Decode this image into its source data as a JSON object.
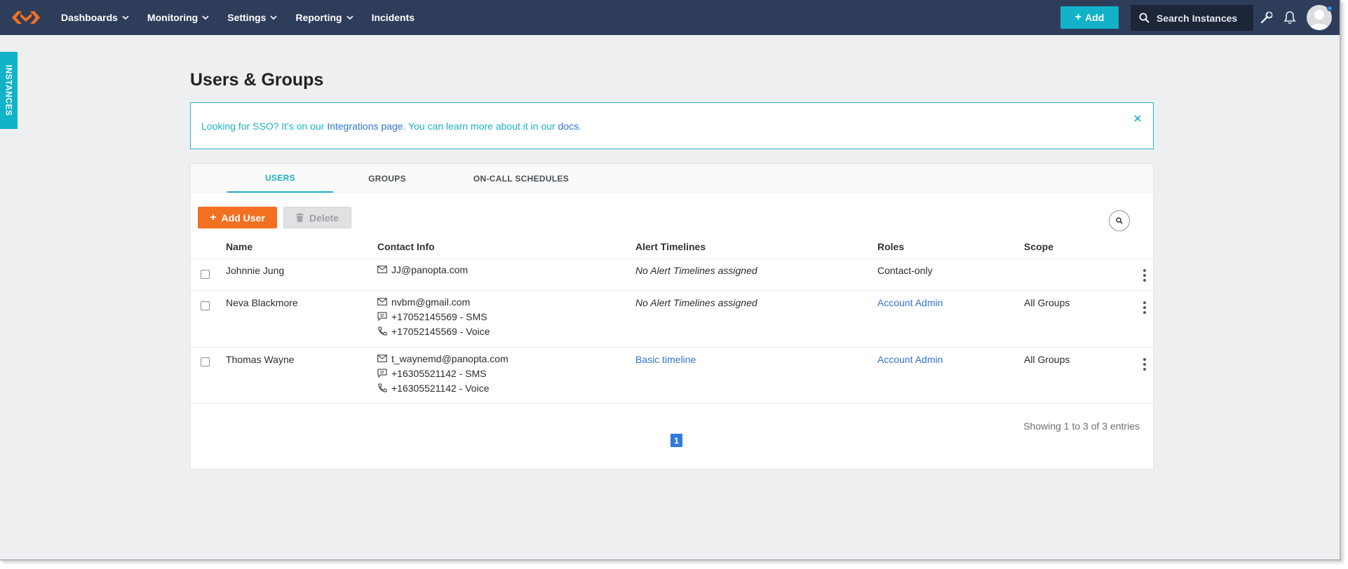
{
  "navbar": {
    "menu": [
      {
        "label": "Dashboards",
        "has_dropdown": true
      },
      {
        "label": "Monitoring",
        "has_dropdown": true
      },
      {
        "label": "Settings",
        "has_dropdown": true
      },
      {
        "label": "Reporting",
        "has_dropdown": true
      },
      {
        "label": "Incidents",
        "has_dropdown": false
      }
    ],
    "add_label": "Add",
    "search_placeholder": "Search Instances",
    "icons": [
      "logo-icon",
      "search-icon",
      "wrench-icon",
      "bell-icon",
      "avatar-icon"
    ],
    "colors": {
      "navbar_bg": "#2e3d5a",
      "accent": "#12b2c9",
      "notification_dot": "#2f8af0"
    }
  },
  "side_tab": {
    "label": "INSTANCES"
  },
  "page": {
    "title": "Users & Groups",
    "alert": {
      "text_1": "Looking for SSO? It's on our ",
      "link_1": "Integrations page",
      "text_2": ". You can learn more about it in our ",
      "link_2": "docs",
      "text_3": "."
    }
  },
  "tabs": [
    {
      "label": "USERS",
      "active": true
    },
    {
      "label": "GROUPS",
      "active": false
    },
    {
      "label": "ON-CALL SCHEDULES",
      "active": false
    }
  ],
  "toolbar": {
    "add_user_label": "Add User",
    "delete_label": "Delete",
    "add_user_color": "#f37021"
  },
  "table": {
    "columns": [
      "Name",
      "Contact Info",
      "Alert Timelines",
      "Roles",
      "Scope"
    ],
    "rows": [
      {
        "name": "Johnnie Jung",
        "contacts": [
          {
            "type": "email",
            "value": "JJ@panopta.com"
          }
        ],
        "alert_timeline": "No Alert Timelines assigned",
        "timeline_is_link": false,
        "role": "Contact-only",
        "role_is_link": false,
        "scope": ""
      },
      {
        "name": "Neva Blackmore",
        "contacts": [
          {
            "type": "email",
            "value": "nvbm@gmail.com"
          },
          {
            "type": "sms",
            "value": "+17052145569 - SMS"
          },
          {
            "type": "voice",
            "value": "+17052145569 - Voice"
          }
        ],
        "alert_timeline": "No Alert Timelines assigned",
        "timeline_is_link": false,
        "role": "Account Admin",
        "role_is_link": true,
        "scope": "All Groups"
      },
      {
        "name": "Thomas Wayne",
        "contacts": [
          {
            "type": "email",
            "value": "t_waynemd@panopta.com"
          },
          {
            "type": "sms",
            "value": "+16305521142 - SMS"
          },
          {
            "type": "voice",
            "value": "+16305521142 - Voice"
          }
        ],
        "alert_timeline": "Basic timeline",
        "timeline_is_link": true,
        "role": "Account Admin",
        "role_is_link": true,
        "scope": "All Groups"
      }
    ],
    "showing_text": "Showing 1 to 3 of 3 entries",
    "current_page": "1"
  }
}
